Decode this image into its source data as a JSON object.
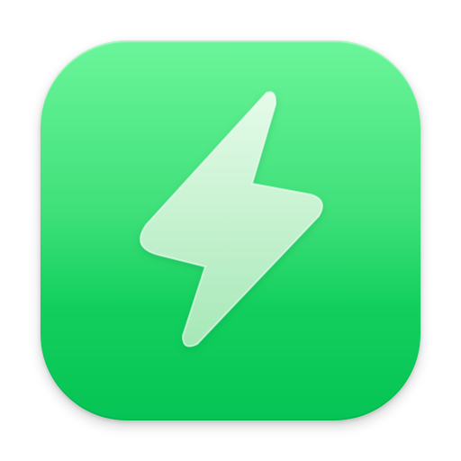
{
  "app_icon": {
    "icon_name": "lightning-bolt-icon",
    "colors": {
      "background_top": "#6bf59a",
      "background_bottom": "#06c455",
      "glyph_top": "#e6fbe9",
      "glyph_bottom": "#a6e8b7"
    }
  }
}
